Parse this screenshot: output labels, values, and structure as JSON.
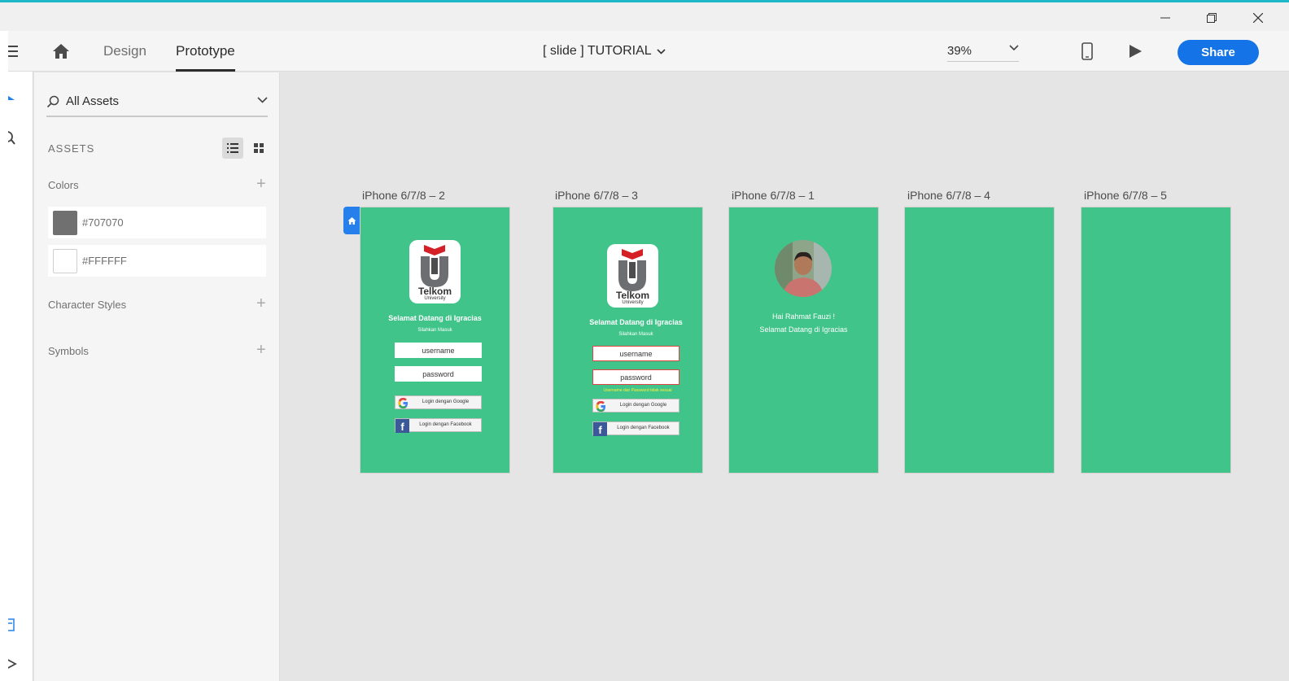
{
  "toolbar": {
    "tabs": [
      {
        "label": "Design",
        "active": false
      },
      {
        "label": "Prototype",
        "active": true
      }
    ],
    "document_title": "[ slide ] TUTORIAL",
    "zoom": "39%",
    "share_label": "Share"
  },
  "assets_panel": {
    "search_placeholder": "All Assets",
    "heading": "ASSETS",
    "colors_label": "Colors",
    "colors": [
      {
        "hex": "#707070",
        "swatch": "#707070"
      },
      {
        "hex": "#FFFFFF",
        "swatch": "#ffffff"
      }
    ],
    "character_styles_label": "Character Styles",
    "symbols_label": "Symbols"
  },
  "artboards": [
    {
      "label": "iPhone 6/7/8 – 2"
    },
    {
      "label": "iPhone 6/7/8 – 3"
    },
    {
      "label": "iPhone 6/7/8 – 1"
    },
    {
      "label": "iPhone 6/7/8 – 4"
    },
    {
      "label": "iPhone 6/7/8 – 5"
    }
  ],
  "login_screen": {
    "logo_text": "Telkom",
    "logo_subtext": "University",
    "welcome": "Selamat Datang di Igracias",
    "subtitle": "Silahkan Masuk",
    "username": "username",
    "password": "password",
    "google_label": "Login dengan Google",
    "facebook_label": "Login dengan Facebook",
    "error_text": "Username dan Password tidak sesuai"
  },
  "home_screen": {
    "greeting": "Hai Rahmat Fauzi !",
    "welcome": "Selamat Datang di Igracias"
  },
  "colors": {
    "artboard_bg": "#41c48a",
    "accent": "#1473e6",
    "window_border": "#1eb8c8"
  }
}
